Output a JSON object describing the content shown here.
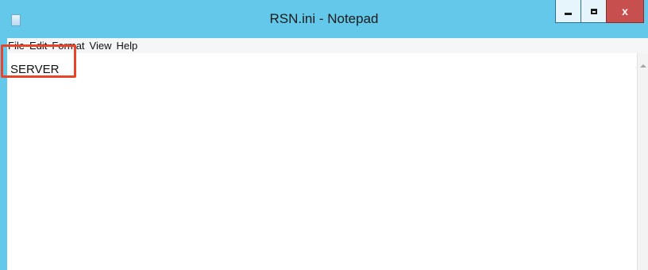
{
  "window": {
    "title": "RSN.ini - Notepad",
    "close_glyph": "x"
  },
  "menu": [
    "File",
    "Edit",
    "Format",
    "View",
    "Help"
  ],
  "editor": {
    "content": "SERVER"
  },
  "icons": {
    "app": "notepad-icon",
    "minimize": "minimize-icon",
    "maximize": "maximize-icon",
    "close": "close-icon",
    "scroll_up": "chevron-up-icon"
  },
  "colors": {
    "titlebar": "#63c8e9",
    "close_button": "#c7504f",
    "highlight": "#e8432b"
  }
}
